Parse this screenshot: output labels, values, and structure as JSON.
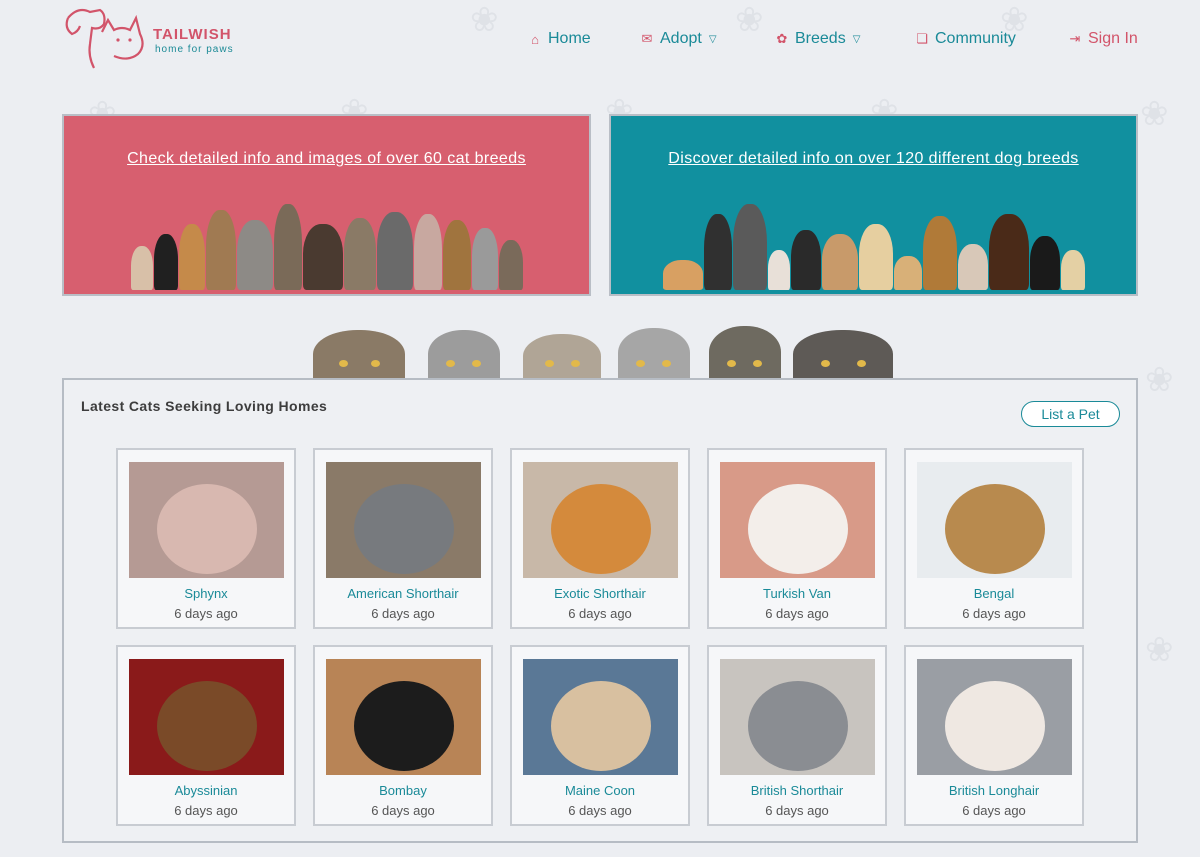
{
  "brand": {
    "name": "TAILWISH",
    "tagline": "home for paws"
  },
  "nav": [
    {
      "label": "Home",
      "icon": "home-icon",
      "has_dropdown": false
    },
    {
      "label": "Adopt",
      "icon": "adopt-icon",
      "has_dropdown": true
    },
    {
      "label": "Breeds",
      "icon": "paw-icon",
      "has_dropdown": true
    },
    {
      "label": "Community",
      "icon": "chat-icon",
      "has_dropdown": false
    },
    {
      "label": "Sign In",
      "icon": "sign-in-icon",
      "has_dropdown": false
    }
  ],
  "banners": {
    "cats": {
      "link": "Check detailed info and images of over 60 cat breeds",
      "color": "#d75f6f"
    },
    "dogs": {
      "link": "Discover detailed info on over 120 different dog breeds",
      "color": "#11909f"
    }
  },
  "panel": {
    "title": "Latest Cats Seeking Loving Homes",
    "list_button": "List a Pet",
    "cards": [
      {
        "name": "Sphynx",
        "ago": "6 days ago",
        "photo_color": "#b59a94",
        "cat_color": "#d8b8b0"
      },
      {
        "name": "American Shorthair",
        "ago": "6 days ago",
        "photo_color": "#8a7a68",
        "cat_color": "#777a7e"
      },
      {
        "name": "Exotic Shorthair",
        "ago": "6 days ago",
        "photo_color": "#c8b8a8",
        "cat_color": "#d48a3c"
      },
      {
        "name": "Turkish Van",
        "ago": "6 days ago",
        "photo_color": "#d89a88",
        "cat_color": "#f3eeea"
      },
      {
        "name": "Bengal",
        "ago": "6 days ago",
        "photo_color": "#e8ecef",
        "cat_color": "#b88a4e"
      },
      {
        "name": "Abyssinian",
        "ago": "6 days ago",
        "photo_color": "#8a1a1a",
        "cat_color": "#7a4a28"
      },
      {
        "name": "Bombay",
        "ago": "6 days ago",
        "photo_color": "#b88456",
        "cat_color": "#1c1c1c"
      },
      {
        "name": "Maine Coon",
        "ago": "6 days ago",
        "photo_color": "#5a7896",
        "cat_color": "#d8c0a0"
      },
      {
        "name": "British Shorthair",
        "ago": "6 days ago",
        "photo_color": "#c8c4bf",
        "cat_color": "#8a8d92"
      },
      {
        "name": "British Longhair",
        "ago": "6 days ago",
        "photo_color": "#9a9ea4",
        "cat_color": "#efe8e2"
      }
    ]
  },
  "colors": {
    "accent_pink": "#d2546a",
    "accent_teal": "#1a8a98",
    "background": "#eceef2"
  }
}
